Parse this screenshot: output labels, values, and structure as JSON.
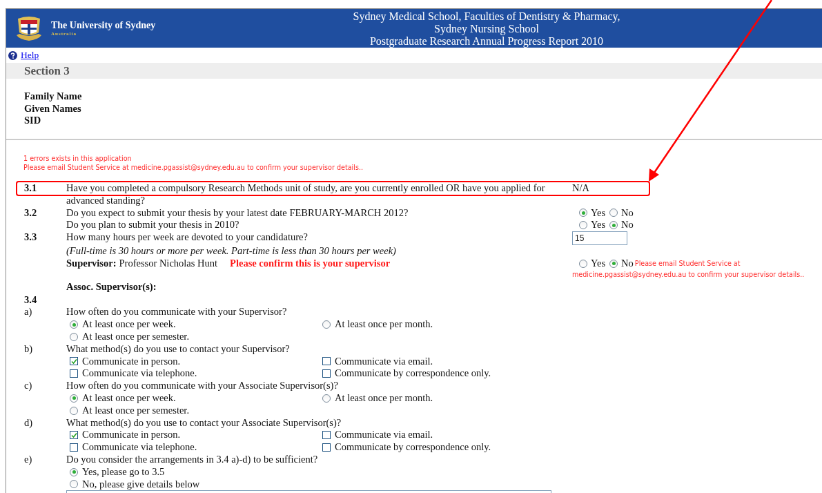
{
  "header": {
    "university": "The University of Sydney",
    "country": "Australia",
    "title_lines": [
      "Sydney Medical School, Faculties of Dentistry & Pharmacy,",
      "Sydney Nursing School",
      "Postgraduate Research Annual Progress Report 2010"
    ]
  },
  "help_link": "Help",
  "section_title": "Section 3",
  "student_fields": [
    "Family Name",
    "Given Names",
    "SID"
  ],
  "errors": [
    "1 errors exists in this application",
    "Please email Student Service at medicine.pgassist@sydney.edu.au to confirm your supervisor details.."
  ],
  "rows": [
    {
      "kind": "question",
      "highlighted": true,
      "number": "3.1",
      "text_lines": [
        "Have you completed a compulsory Research Methods unit of study, are you currently enrolled OR have you applied for",
        "advanced standing?"
      ],
      "answer": {
        "kind": "text",
        "value": "N/A"
      }
    },
    {
      "kind": "question",
      "number": "3.2",
      "text": "Do you expect to submit your thesis by your latest date FEBRUARY-MARCH 2012?",
      "answer": {
        "kind": "radios",
        "options": [
          {
            "label": "Yes",
            "selected": true
          },
          {
            "label": "No",
            "selected": false
          }
        ]
      }
    },
    {
      "kind": "question",
      "text": "Do you plan to submit your thesis in 2010?",
      "answer": {
        "kind": "radios",
        "options": [
          {
            "label": "Yes",
            "selected": false
          },
          {
            "label": "No",
            "selected": true
          }
        ]
      }
    },
    {
      "kind": "question",
      "number": "3.3",
      "text": "How many hours per week are devoted to your candidature?",
      "answer": {
        "kind": "input",
        "value": "15"
      }
    },
    {
      "kind": "note",
      "text": "(Full-time is 30 hours or more per week. Part-time is less than 30 hours per week)"
    },
    {
      "kind": "supervisor",
      "label": "Supervisor:",
      "name": "Professor Nicholas Hunt",
      "warning": "Please confirm this is your supervisor",
      "answer": {
        "kind": "radios",
        "options": [
          {
            "label": "Yes",
            "selected": false
          },
          {
            "label": "No",
            "selected": true
          }
        ],
        "message_lines": [
          "Please email Student Service at",
          "medicine.pgassist@sydney.edu.au to confirm your supervisor details.."
        ]
      }
    },
    {
      "kind": "heading",
      "text": "Assoc. Supervisor(s):"
    }
  ],
  "section_3_4": {
    "number": "3.4",
    "parts": [
      {
        "letter": "a)",
        "text": "How often do you communicate with your Supervisor?",
        "kind": "radiogrid",
        "options": [
          {
            "label": "At least once per week.",
            "selected": true
          },
          {
            "label": "At least once per month.",
            "selected": false
          },
          {
            "label": "At least once per semester.",
            "selected": false
          }
        ]
      },
      {
        "letter": "b)",
        "text": "What method(s) do you use to contact your Supervisor?",
        "kind": "checkgrid",
        "options": [
          {
            "label": "Communicate in person.",
            "checked": true
          },
          {
            "label": "Communicate via email.",
            "checked": false
          },
          {
            "label": "Communicate via telephone.",
            "checked": false
          },
          {
            "label": "Communicate by correspondence only.",
            "checked": false
          }
        ]
      },
      {
        "letter": "c)",
        "text": "How often do you communicate with your Associate Supervisor(s)?",
        "kind": "radiogrid",
        "options": [
          {
            "label": "At least once per week.",
            "selected": true
          },
          {
            "label": "At least once per month.",
            "selected": false
          },
          {
            "label": "At least once per semester.",
            "selected": false
          }
        ]
      },
      {
        "letter": "d)",
        "text": "What method(s) do you use to contact your Associate Supervisor(s)?",
        "kind": "checkgrid",
        "options": [
          {
            "label": "Communicate in person.",
            "checked": true
          },
          {
            "label": "Communicate via email.",
            "checked": false
          },
          {
            "label": "Communicate via telephone.",
            "checked": false
          },
          {
            "label": "Communicate by correspondence only.",
            "checked": false
          }
        ]
      },
      {
        "letter": "e)",
        "text": "Do you consider the arrangements in 3.4 a)-d) to be sufficient?",
        "kind": "radiolist",
        "options": [
          {
            "label": "Yes, please go to 3.5",
            "selected": true
          },
          {
            "label": "No, please give details below",
            "selected": false
          }
        ]
      }
    ]
  }
}
